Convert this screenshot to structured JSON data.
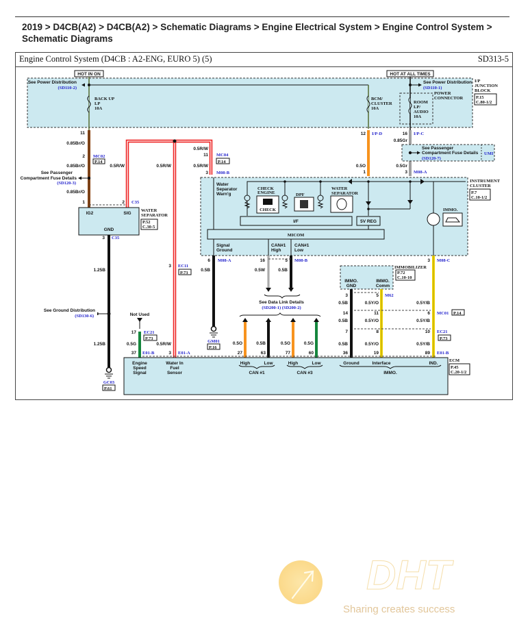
{
  "breadcrumb": {
    "line1": "2019 > D4CB(A2) > D4CB(A2) > Schematic Diagrams > Engine Electrical System > Engine Control System >",
    "line2": "Schematic Diagrams"
  },
  "sheet": {
    "title": "Engine Control System (D4CB : A2-ENG, EURO 5) (5)",
    "code": "SD313-5"
  },
  "power": {
    "hot_in_on": "HOT IN ON",
    "hot_at_all_times": "HOT AT ALL TIMES",
    "see_power_dist_left": "See Power Distribution",
    "see_power_dist_left_ref": "(SD110-2)",
    "see_power_dist_right": "See Power Distribution",
    "see_power_dist_right_ref": "(SD110-1)",
    "fuse_backup": [
      "BACK UP",
      "LP",
      "10A"
    ],
    "fuse_bcm": [
      "BCM/",
      "CLUSTER",
      "10A"
    ],
    "fuse_room": [
      "ROOM",
      "LP/",
      "AUDIO",
      "10A"
    ],
    "power_connector": [
      "POWER",
      "CONNECTOR"
    ],
    "junction_block": [
      "I/P",
      "JUNCTION",
      "BLOCK"
    ],
    "junction_ref": [
      "P.15",
      "C.80-1/2"
    ]
  },
  "wires": {
    "pin11": "11",
    "w085bro_1": "0.85Br/O",
    "mc02_pin": "2",
    "mc02": "MC02",
    "p14a": "P.14",
    "w085bro_2": "0.85Br/O",
    "see_passenger_left": [
      "See Passenger",
      "Compartment Fuse Details"
    ],
    "see_passenger_left_ref": "(SD120-3)",
    "w085bro_3": "0.85Br/O",
    "pin1_ws": "1",
    "pin2_ws": "2",
    "c35": "C35",
    "w05rw_a": "0.5R/W",
    "w05rw_b": "0.5R/W",
    "w05rw_c": "0.5R/W",
    "w05rw_d": "0.5R/W",
    "mc04_pin": "11",
    "mc04": "MC04",
    "p14b": "P.14",
    "m08b_pin": "3",
    "m08b": "M08-B",
    "pin12": "12",
    "ipd": "I/P-D",
    "pin16": "16",
    "ipc": "I/P-C",
    "w085gr": "0.85Gr",
    "see_passenger_right": [
      "See Passenger",
      "Compartment Fuse Details"
    ],
    "see_passenger_right_ref": "(SD120-7)",
    "umi": "UMI",
    "w05o": "0.5O",
    "pin1_cl": "1",
    "w05gr": "0.5Gr",
    "m08a_pin_top": "3",
    "m08a_top": "M08-A"
  },
  "water_separator": {
    "ig2": "IG2",
    "sig": "SIG",
    "gnd": "GND",
    "name": [
      "WATER",
      "SEPARATOR"
    ],
    "ref": [
      "P.52",
      "C.30-5"
    ],
    "gnd_pin": "3",
    "gnd_conn": "C35",
    "w125b_a": "1.25B",
    "see_ground": "See Ground Distribution",
    "see_ground_ref": "(SD130-6)",
    "w125b_b": "1.25B",
    "gc03": "GC03",
    "p61": "P.61"
  },
  "cluster": {
    "water_sep_warn": [
      "Water",
      "Separator",
      "Warn'g"
    ],
    "check_engine": [
      "CHECK",
      "ENGINE"
    ],
    "check_label": "CHECK",
    "dpf": "DPF",
    "water_separator": [
      "WATER",
      "SEPARATOR"
    ],
    "if": "I/F",
    "micom": "MICOM",
    "reg": "5V REG",
    "immo": "IMMO.",
    "signal_ground": [
      "Signal",
      "Ground"
    ],
    "can1_high": [
      "CAN#1",
      "High"
    ],
    "can1_low": [
      "CAN#1",
      "Low"
    ],
    "name": [
      "INSTRUMENT",
      "CLUSTER"
    ],
    "ref": [
      "P.7",
      "C.10-1/2"
    ]
  },
  "lower": {
    "ec11_pin": "3",
    "ec11": "EC11",
    "p73a": "P.73",
    "m08a_pin": "6",
    "m08a": "M08-A",
    "w05b_sg": "0.5B",
    "pin16b": "16",
    "w05w": "0.5W",
    "pin5": "5",
    "m08b2": "M08-B",
    "w05b_can": "0.5B",
    "gm01": "GM01",
    "p16": "P.16",
    "data_link": "See Data Link Details",
    "data_link_ref": "(SD200-1) (SD200-2)",
    "not_used": "Not Used",
    "ec21_pin": "17",
    "ec21": "EC21",
    "p73b": "P.73",
    "w05g": "0.5G",
    "w05rw_e": "0.5R/W",
    "pin37": "37",
    "e01b": "E01-B",
    "pin3e": "3",
    "e01a": "E01-A",
    "w05o_a": "0.5O",
    "w05b_a": "0.5B",
    "w05o_b": "0.5O",
    "w05g_b": "0.5G",
    "pin27": "27",
    "pin63": "63",
    "pin77": "77",
    "pin60": "60",
    "m08c_pin": "3",
    "m08c": "M08-C"
  },
  "immobilizer": {
    "gnd": [
      "IMMO.",
      "GND"
    ],
    "comm": [
      "IMMO.",
      "Comm"
    ],
    "name": "IMMOBILIZER",
    "ref": [
      "P.72",
      "C.10-10"
    ],
    "pin3": "3",
    "pin5": "5",
    "m62": "M62",
    "rows": [
      {
        "b": "0.5B",
        "yo": "0.5Y/O",
        "yb": "0.5Y/B"
      },
      {
        "b": "0.5B",
        "yo": "0.5Y/O",
        "yb": "0.5Y/B"
      },
      {
        "b": "0.5B",
        "yo": "0.5Y/O",
        "yb": "0.5Y/B"
      },
      {
        "b": "0.5B",
        "yo": "0.5Y/O",
        "yb": "0.5Y/B"
      }
    ],
    "pins_row1": [
      "14",
      "11",
      "6"
    ],
    "mc01": "MC01",
    "p14c": "P.14",
    "pins_row2": [
      "7",
      "8",
      "10"
    ],
    "ec21": "EC21",
    "p73c": "P.73",
    "pins_ecm": [
      "36",
      "19",
      "89"
    ],
    "e01b": "E01-B"
  },
  "ecm": {
    "engine_speed": [
      "Engine",
      "Speed",
      "Signal"
    ],
    "water_in_fuel": [
      "Water In",
      "Fuel",
      "Sensor"
    ],
    "high": "High",
    "low": "Low",
    "can1": "CAN #1",
    "can3": "CAN #3",
    "ground": "Ground",
    "interface": "Interface",
    "ind": "IND.",
    "immo": "IMMO.",
    "name": "ECM",
    "ref": [
      "P.45",
      "C.20-1/2"
    ]
  },
  "watermark": {
    "brand": "DHT",
    "slogan": "Sharing creates success"
  }
}
